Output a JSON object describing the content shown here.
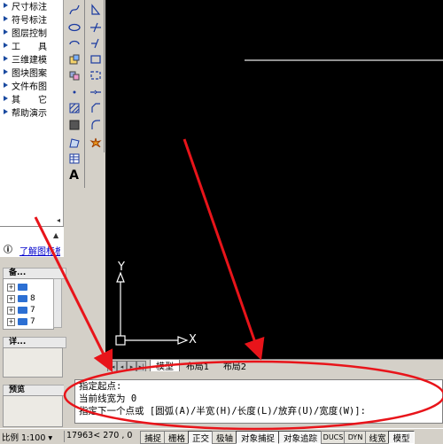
{
  "menu": {
    "items": [
      {
        "label": "尺寸标注"
      },
      {
        "label": "符号标注"
      },
      {
        "label": "图层控制"
      },
      {
        "label": "工　　具"
      },
      {
        "label": "三维建模"
      },
      {
        "label": "图块图案"
      },
      {
        "label": "文件布图"
      },
      {
        "label": "其　　它"
      },
      {
        "label": "帮助演示"
      }
    ]
  },
  "info": {
    "link": "了解图标板"
  },
  "panels": {
    "bei": {
      "title": "备...",
      "rows": [
        "",
        "8",
        "7",
        "7"
      ]
    },
    "xiang": {
      "title": "详..."
    },
    "yulan": {
      "title": "预览"
    }
  },
  "canvas": {
    "axis_y": "Y",
    "axis_x": "X"
  },
  "tabs": {
    "model": "模型",
    "layout1": "布局1",
    "layout2": "布局2"
  },
  "command": {
    "lines": [
      "指定起点:",
      "当前线宽为 0",
      "指定下一个点或 [圆弧(A)/半宽(H)/长度(L)/放弃(U)/宽度(W)]:"
    ]
  },
  "status": {
    "scale": "比例 1:100 ▾",
    "coords": "17963< 270  , 0",
    "buttons": [
      "捕捉",
      "栅格",
      "正交",
      "极轴",
      "对象捕捉",
      "对象追踪",
      "DUCS",
      "DYN",
      "线宽",
      "模型"
    ]
  },
  "colors": {
    "annotation": "#e8141a",
    "canvas_bg": "#000000",
    "menu_arrow": "#1a4aa0"
  }
}
